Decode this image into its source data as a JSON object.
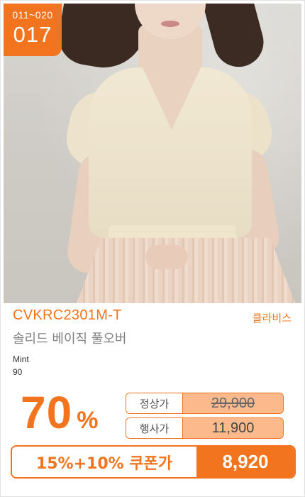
{
  "badge": {
    "range": "011~020",
    "rank": "017"
  },
  "product": {
    "code": "CVKRC2301M-T",
    "brand": "클라비스",
    "name": "솔리드 베이직 풀오버",
    "color": "Mint",
    "size": "90",
    "image_icon": "product-photo"
  },
  "discount": {
    "value": "70",
    "unit": "%"
  },
  "prices": {
    "regular_label": "정상가",
    "regular_value": "29,900",
    "event_label": "행사가",
    "event_value": "11,900"
  },
  "coupon": {
    "label": "15%+10% 쿠폰가",
    "value": "8,920"
  },
  "colors": {
    "accent": "#f2741f",
    "price_fill": "#fbb98c"
  }
}
